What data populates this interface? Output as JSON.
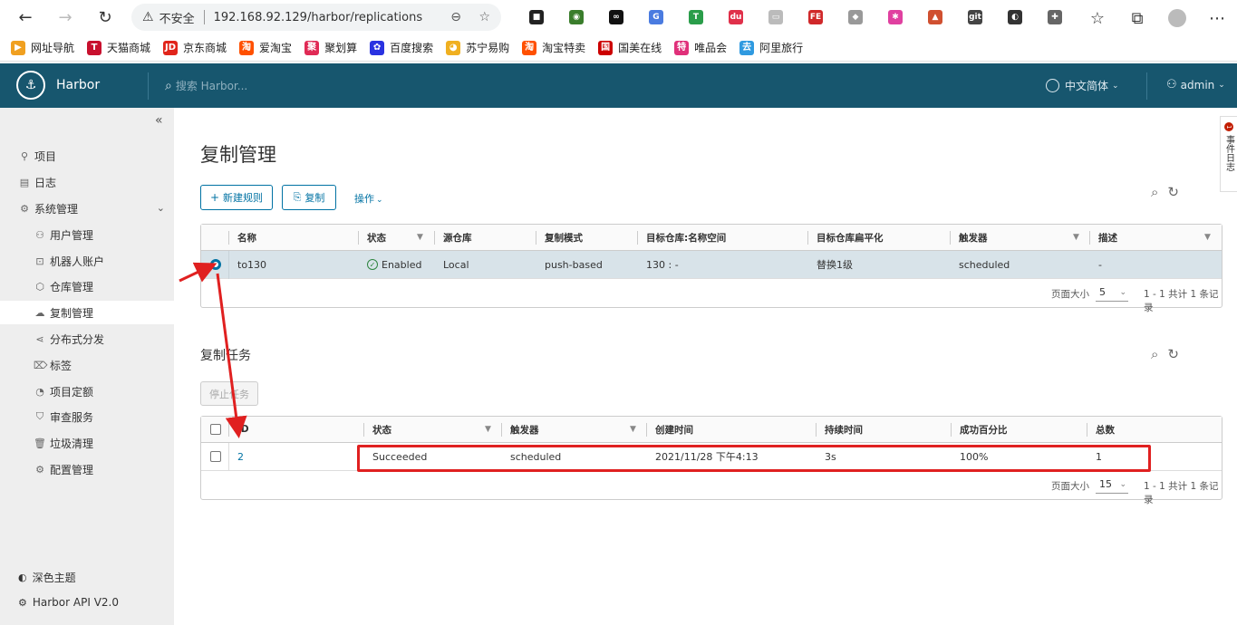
{
  "browser": {
    "insecure_label": "不安全",
    "url": "192.168.92.129/harbor/replications",
    "extensions": [
      {
        "name": "ext-1",
        "color": "#222",
        "glyph": "■"
      },
      {
        "name": "ext-2",
        "color": "#3a7d2c",
        "glyph": "◉"
      },
      {
        "name": "ext-3",
        "color": "#111",
        "glyph": "∞"
      },
      {
        "name": "ext-translate",
        "color": "#4a7be0",
        "glyph": "G"
      },
      {
        "name": "ext-shield",
        "color": "#2a9d4a",
        "glyph": "T"
      },
      {
        "name": "ext-du",
        "color": "#e0304a",
        "glyph": "du"
      },
      {
        "name": "ext-6",
        "color": "#bbb",
        "glyph": "▭"
      },
      {
        "name": "ext-fe",
        "color": "#d0282a",
        "glyph": "FE"
      },
      {
        "name": "ext-8",
        "color": "#999",
        "glyph": "◆"
      },
      {
        "name": "ext-9",
        "color": "#e040a0",
        "glyph": "✱"
      },
      {
        "name": "ext-10",
        "color": "#d05030",
        "glyph": "▲"
      },
      {
        "name": "ext-gitzip",
        "color": "#444",
        "glyph": "git"
      },
      {
        "name": "ext-12",
        "color": "#333",
        "glyph": "◐"
      },
      {
        "name": "ext-puzzle",
        "color": "#666",
        "glyph": "✚"
      }
    ]
  },
  "bookmarks": [
    {
      "label": "网址导航",
      "color": "#f0a020",
      "glyph": "▶"
    },
    {
      "label": "天猫商城",
      "color": "#c8102e",
      "glyph": "T"
    },
    {
      "label": "京东商城",
      "color": "#e1251b",
      "glyph": "JD"
    },
    {
      "label": "爱淘宝",
      "color": "#ff5000",
      "glyph": "淘"
    },
    {
      "label": "聚划算",
      "color": "#e02a55",
      "glyph": "聚"
    },
    {
      "label": "百度搜索",
      "color": "#2932e1",
      "glyph": "✿"
    },
    {
      "label": "苏宁易购",
      "color": "#f0b020",
      "glyph": "◕"
    },
    {
      "label": "淘宝特卖",
      "color": "#ff5000",
      "glyph": "淘"
    },
    {
      "label": "国美在线",
      "color": "#c00",
      "glyph": "国"
    },
    {
      "label": "唯品会",
      "color": "#e0307a",
      "glyph": "特"
    },
    {
      "label": "阿里旅行",
      "color": "#2f9ae0",
      "glyph": "去"
    }
  ],
  "header": {
    "brand": "Harbor",
    "search_placeholder": "搜索 Harbor...",
    "language": "中文简体",
    "user": "admin",
    "bg_color": "#17566e"
  },
  "sidebar": {
    "items": [
      {
        "label": "项目",
        "level": "top"
      },
      {
        "label": "日志",
        "level": "top"
      },
      {
        "label": "系统管理",
        "level": "top"
      },
      {
        "label": "用户管理",
        "level": "sub"
      },
      {
        "label": "机器人账户",
        "level": "sub"
      },
      {
        "label": "仓库管理",
        "level": "sub"
      },
      {
        "label": "复制管理",
        "level": "sub",
        "active": true
      },
      {
        "label": "分布式分发",
        "level": "sub"
      },
      {
        "label": "标签",
        "level": "sub"
      },
      {
        "label": "项目定额",
        "level": "sub"
      },
      {
        "label": "审查服务",
        "level": "sub"
      },
      {
        "label": "垃圾清理",
        "level": "sub"
      },
      {
        "label": "配置管理",
        "level": "sub"
      }
    ],
    "dark_theme": "深色主题",
    "api": "Harbor API V2.0"
  },
  "page": {
    "title": "复制管理",
    "new_rule": "新建规则",
    "replicate": "复制",
    "actions": "操作",
    "side_tab": "事件日志",
    "side_badge": "1"
  },
  "rules_table": {
    "headers": [
      "名称",
      "状态",
      "源仓库",
      "复制模式",
      "目标仓库:名称空间",
      "目标仓库扁平化",
      "触发器",
      "描述"
    ],
    "rows": [
      {
        "name": "to130",
        "status": "Enabled",
        "source": "Local",
        "mode": "push-based",
        "dest": "130 : -",
        "flatten": "替换1级",
        "trigger": "scheduled",
        "desc": "-"
      }
    ],
    "page_size_label": "页面大小",
    "page_size": "5",
    "summary": "1 - 1 共计 1 条记录"
  },
  "tasks": {
    "title": "复制任务",
    "stop_label": "停止任务",
    "headers": [
      "ID",
      "状态",
      "触发器",
      "创建时间",
      "持续时间",
      "成功百分比",
      "总数"
    ],
    "rows": [
      {
        "id": "2",
        "status": "Succeeded",
        "trigger": "scheduled",
        "created": "2021/11/28 下午4:13",
        "duration": "3s",
        "percent": "100%",
        "total": "1"
      }
    ],
    "page_size_label": "页面大小",
    "page_size": "15",
    "summary": "1 - 1 共计 1 条记录"
  }
}
